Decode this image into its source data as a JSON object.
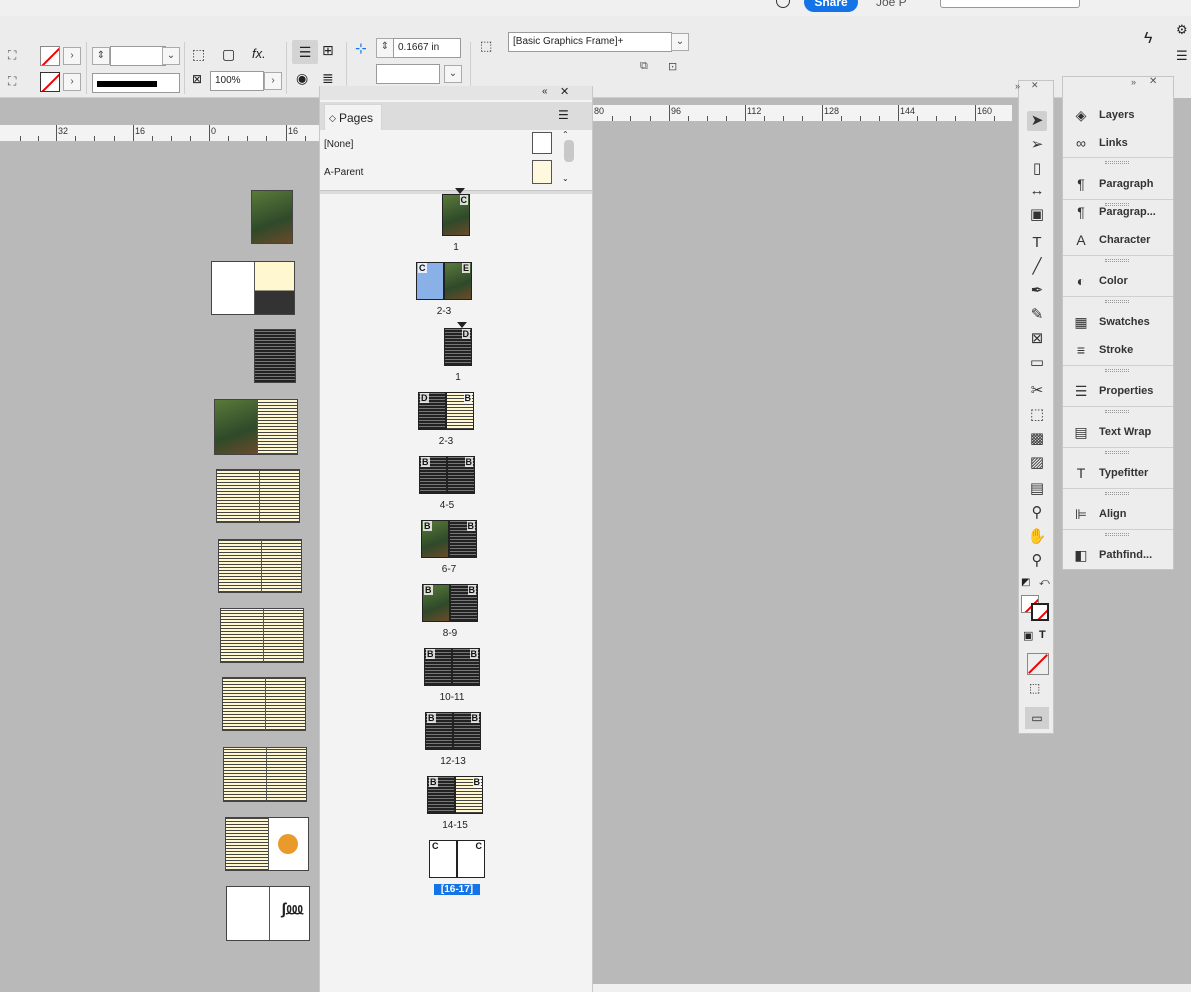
{
  "topbar": {
    "share_label": "Share",
    "user_label": "Joe P"
  },
  "control_bar": {
    "stroke_weight": "",
    "offset_value": "0.1667 in",
    "scale_value": "100%",
    "object_style": "[Basic Graphics Frame]+",
    "fx_label": "fx."
  },
  "ruler": {
    "left_ticks": [
      "32",
      "16",
      "0",
      "16"
    ],
    "right_ticks": [
      "80",
      "96",
      "112",
      "128",
      "144",
      "160"
    ]
  },
  "pages_panel": {
    "tab_label": "Pages",
    "parents": [
      {
        "label": "[None]",
        "swatch": "#ffffff"
      },
      {
        "label": "A-Parent",
        "swatch": "#fdf8de"
      }
    ],
    "spreads": [
      {
        "label": "1",
        "letters": [
          "C"
        ],
        "fill": [
          "photo"
        ]
      },
      {
        "label": "2-3",
        "letters": [
          "C",
          "E"
        ],
        "fill": [
          "blue",
          "photo"
        ]
      },
      {
        "label": "1",
        "letters": [
          "D"
        ],
        "fill": [
          "dark"
        ]
      },
      {
        "label": "2-3",
        "letters": [
          "D",
          "B"
        ],
        "fill": [
          "dark",
          "yellow"
        ]
      },
      {
        "label": "4-5",
        "letters": [
          "B",
          "B"
        ],
        "fill": [
          "dark",
          "dark"
        ]
      },
      {
        "label": "6-7",
        "letters": [
          "B",
          "B"
        ],
        "fill": [
          "photo",
          "dark"
        ]
      },
      {
        "label": "8-9",
        "letters": [
          "B",
          "B"
        ],
        "fill": [
          "photo",
          "dark"
        ]
      },
      {
        "label": "10-11",
        "letters": [
          "B",
          "B"
        ],
        "fill": [
          "dark",
          "dark"
        ]
      },
      {
        "label": "12-13",
        "letters": [
          "B",
          "B"
        ],
        "fill": [
          "dark",
          "dark"
        ]
      },
      {
        "label": "14-15",
        "letters": [
          "B",
          "B"
        ],
        "fill": [
          "dark",
          "yellow"
        ]
      },
      {
        "label": "[16-17]",
        "letters": [
          "C",
          "C"
        ],
        "fill": [
          "white",
          "white"
        ],
        "selected": true
      }
    ]
  },
  "dock": {
    "items": [
      {
        "label": "Layers",
        "icon": "layers-icon",
        "glyph": "◈"
      },
      {
        "label": "Links",
        "icon": "links-icon",
        "glyph": "∞"
      },
      {
        "label": "Paragraph",
        "icon": "paragraph-icon",
        "glyph": "¶"
      },
      {
        "label": "Paragrap...",
        "icon": "paragraph-styles-icon",
        "glyph": "¶"
      },
      {
        "label": "Character",
        "icon": "character-icon",
        "glyph": "A"
      },
      {
        "label": "Color",
        "icon": "color-icon",
        "glyph": "◐"
      },
      {
        "label": "Swatches",
        "icon": "swatches-icon",
        "glyph": "▦"
      },
      {
        "label": "Stroke",
        "icon": "stroke-icon",
        "glyph": "≡"
      },
      {
        "label": "Properties",
        "icon": "properties-icon",
        "glyph": "☰"
      },
      {
        "label": "Text Wrap",
        "icon": "text-wrap-icon",
        "glyph": "▤"
      },
      {
        "label": "Typefitter",
        "icon": "typefitter-icon",
        "glyph": "T"
      },
      {
        "label": "Align",
        "icon": "align-icon",
        "glyph": "⊫"
      },
      {
        "label": "Pathfind...",
        "icon": "pathfinder-icon",
        "glyph": "◧"
      }
    ]
  },
  "tools": [
    {
      "name": "selection-tool-icon",
      "glyph": "➤"
    },
    {
      "name": "direct-selection-tool-icon",
      "glyph": "➢"
    },
    {
      "name": "page-tool-icon",
      "glyph": "▯"
    },
    {
      "name": "gap-tool-icon",
      "glyph": "↔"
    },
    {
      "name": "content-collector-icon",
      "glyph": "▣"
    },
    {
      "name": "type-tool-icon",
      "glyph": "T"
    },
    {
      "name": "line-tool-icon",
      "glyph": "╱"
    },
    {
      "name": "pen-tool-icon",
      "glyph": "✒"
    },
    {
      "name": "pencil-tool-icon",
      "glyph": "✎"
    },
    {
      "name": "rectangle-frame-tool-icon",
      "glyph": "⊠"
    },
    {
      "name": "rectangle-tool-icon",
      "glyph": "▭"
    },
    {
      "name": "scissors-tool-icon",
      "glyph": "✂"
    },
    {
      "name": "free-transform-tool-icon",
      "glyph": "⬚"
    },
    {
      "name": "gradient-tool-icon",
      "glyph": "▩"
    },
    {
      "name": "gradient-feather-tool-icon",
      "glyph": "▨"
    },
    {
      "name": "note-tool-icon",
      "glyph": "▤"
    },
    {
      "name": "eyedropper-tool-icon",
      "glyph": "⚲"
    },
    {
      "name": "hand-tool-icon",
      "glyph": "✋"
    },
    {
      "name": "zoom-tool-icon",
      "glyph": "⚲"
    }
  ]
}
